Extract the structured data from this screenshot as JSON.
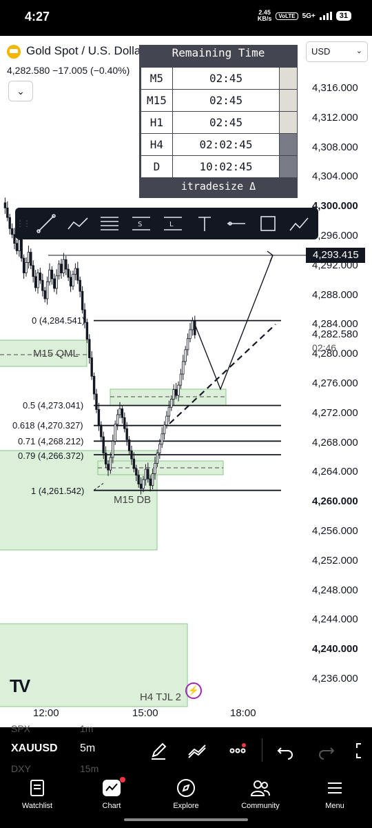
{
  "status_bar": {
    "time": "4:27",
    "speed": "2.45",
    "speed_unit": "KB/s",
    "network": "5G+",
    "sim": "VoLTE",
    "battery": "31"
  },
  "header": {
    "instrument": "Gold Spot / U.S. Dollar",
    "price_line": "4,282.580  −17.005 (−0.40%)",
    "currency": "USD"
  },
  "remaining_time": {
    "title": "Remaining Time",
    "rows": [
      {
        "tf": "M5",
        "value": "02:45"
      },
      {
        "tf": "M15",
        "value": "02:45"
      },
      {
        "tf": "H1",
        "value": "02:45"
      },
      {
        "tf": "H4",
        "value": "02:02:45"
      },
      {
        "tf": "D",
        "value": "10:02:45"
      }
    ],
    "footer": "itradesize Δ"
  },
  "drawing_tools": [
    "trend-line",
    "path",
    "horizontal-lines",
    "short-position",
    "long-position",
    "text",
    "horizontal-ray",
    "rectangle",
    "indicator"
  ],
  "price_axis": {
    "ticks": [
      "4,316.000",
      "4,312.000",
      "4,308.000",
      "4,304.000",
      "4,300.000",
      "4,296.000",
      "4,292.000",
      "4,288.000",
      "4,284.000",
      "4,280.000",
      "4,276.000",
      "4,272.000",
      "4,268.000",
      "4,264.000",
      "4,260.000",
      "4,256.000",
      "4,252.000",
      "4,248.000",
      "4,244.000",
      "4,240.000",
      "4,236.000"
    ],
    "crosshair_price": "4,293.415",
    "last_price": "4,282.580",
    "countdown": "02:46"
  },
  "fib_levels": [
    {
      "label": "0 (4,284.541)",
      "price": 4284.541
    },
    {
      "label": "0.5 (4,273.041)",
      "price": 4273.041
    },
    {
      "label": "0.618 (4,270.327)",
      "price": 4270.327
    },
    {
      "label": "0.71 (4,268.212)",
      "price": 4268.212
    },
    {
      "label": "0.79 (4,266.372)",
      "price": 4266.372
    },
    {
      "label": "1 (4,261.542)",
      "price": 4261.542
    }
  ],
  "zones": {
    "m15_qml": "M15 QML",
    "m15_db": "M15 DB",
    "h4_tjl": "H4 TJL 2"
  },
  "time_axis": [
    "12:00",
    "15:00",
    "18:00"
  ],
  "instrument_bar": {
    "symbol": "XAUUSD",
    "timeframe": "5m",
    "ghost_above": "SPX",
    "ghost_above_tf": "1m",
    "ghost_below": "DXY",
    "ghost_below_tf": "15m"
  },
  "nav": [
    {
      "label": "Watchlist",
      "icon": "watchlist-icon"
    },
    {
      "label": "Chart",
      "icon": "chart-icon"
    },
    {
      "label": "Explore",
      "icon": "compass-icon"
    },
    {
      "label": "Community",
      "icon": "community-icon"
    },
    {
      "label": "Menu",
      "icon": "hamburger-icon"
    }
  ],
  "colors": {
    "zone_fill": "#dcefd8",
    "zone_stroke": "#8bc48a",
    "ink": "#131722",
    "accent_purple": "#9c27b0",
    "notification": "#f23645"
  }
}
